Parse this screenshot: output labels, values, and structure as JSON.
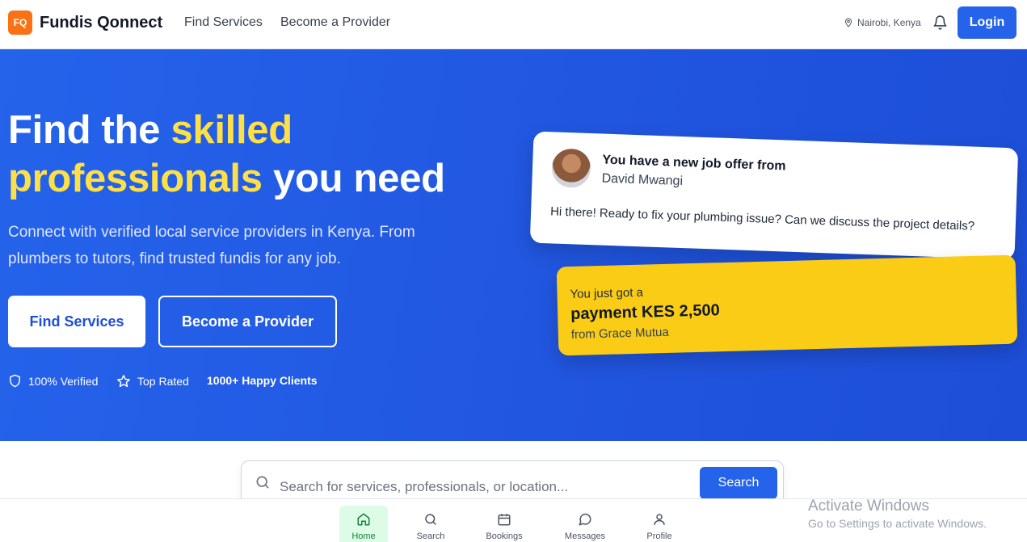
{
  "header": {
    "logo": "FQ",
    "brand": "Fundis Qonnect",
    "nav": [
      "Find Services",
      "Become a Provider"
    ],
    "location": "Nairobi, Kenya",
    "login": "Login"
  },
  "hero": {
    "title_1": "Find the ",
    "title_hl_1": "skilled",
    "title_hl_2": "professionals",
    "title_2": " you need",
    "subtitle": "Connect with verified local service providers in Kenya. From plumbers to tutors, find trusted fundis for any job.",
    "btn_find": "Find Services",
    "btn_provider": "Become a Provider",
    "trust": [
      "100% Verified",
      "Top Rated",
      "1000+ Happy Clients"
    ]
  },
  "offer_card": {
    "title": "You have a new job offer from",
    "name": "David Mwangi",
    "message": "Hi there! Ready to fix your plumbing issue? Can we discuss the project details?"
  },
  "payment_card": {
    "top": "You just got a",
    "amount": "payment KES 2,500",
    "from": "from Grace Mutua"
  },
  "search": {
    "placeholder": "Search for services, professionals, or location...",
    "button": "Search"
  },
  "bottom_nav": [
    "Home",
    "Search",
    "Bookings",
    "Messages",
    "Profile"
  ],
  "watermark": {
    "line1": "Activate Windows",
    "line2": "Go to Settings to activate Windows."
  },
  "colors": {
    "primary": "#2563eb",
    "accent": "#fde047",
    "payment_card": "#facc15",
    "logo": "#f97316"
  }
}
